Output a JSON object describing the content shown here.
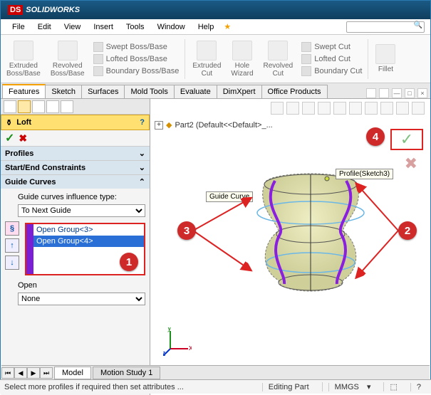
{
  "app": {
    "brand_prefix": "DS",
    "brand": "SOLIDWORKS"
  },
  "menu": [
    "File",
    "Edit",
    "View",
    "Insert",
    "Tools",
    "Window",
    "Help"
  ],
  "ribbon": {
    "extruded_boss": "Extruded\nBoss/Base",
    "revolved_boss": "Revolved\nBoss/Base",
    "swept_boss": "Swept Boss/Base",
    "lofted_boss": "Lofted Boss/Base",
    "boundary_boss": "Boundary Boss/Base",
    "extruded_cut": "Extruded\nCut",
    "hole_wizard": "Hole\nWizard",
    "revolved_cut": "Revolved\nCut",
    "swept_cut": "Swept Cut",
    "lofted_cut": "Lofted Cut",
    "boundary_cut": "Boundary Cut",
    "fillet": "Fillet"
  },
  "tabs": [
    "Features",
    "Sketch",
    "Surfaces",
    "Mold Tools",
    "Evaluate",
    "DimXpert",
    "Office Products"
  ],
  "pm": {
    "title": "Loft",
    "profiles": "Profiles",
    "startend": "Start/End Constraints",
    "guide": "Guide Curves",
    "influence_label": "Guide curves influence type:",
    "influence_value": "To Next Guide",
    "items": [
      "Open Group<3>",
      "Open Group<4>"
    ],
    "open": "Open",
    "none": "None"
  },
  "viewport": {
    "fm_root": "Part2  (Default<<Default>_...",
    "callout_guide": "Guide Curve",
    "callout_profile": "Profile(Sketch3)"
  },
  "steps": {
    "s1": "1",
    "s2": "2",
    "s3": "3",
    "s4": "4"
  },
  "bottom_tabs": {
    "model": "Model",
    "motion": "Motion Study 1"
  },
  "status": {
    "hint": "Select more profiles if required then set attributes ...",
    "mode": "Editing Part",
    "units": "MMGS"
  }
}
